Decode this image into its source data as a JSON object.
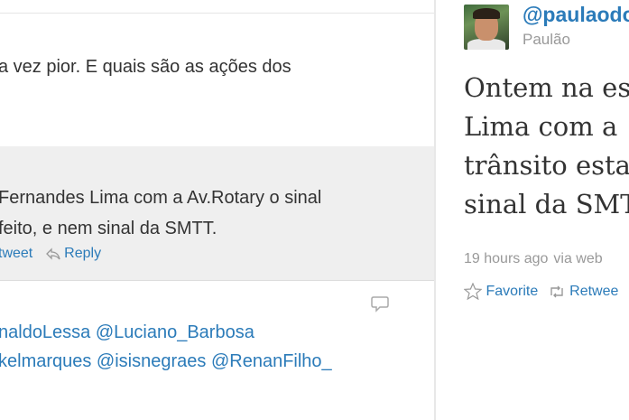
{
  "timeline": {
    "tweet1": {
      "text": "a vez pior. E quais são as ações dos"
    },
    "tweet2": {
      "line1": "Fernandes Lima com a Av.Rotary o sinal",
      "line2": "feito, e nem sinal da SMTT.",
      "retweet": "tweet",
      "reply": "Reply"
    },
    "tweet3": {
      "line1": "naldoLessa @Luciano_Barbosa",
      "line2": "kelmarques @isisnegraes @RenanFilho_"
    }
  },
  "detail": {
    "screen_name": "@paulaodo",
    "real_name": "Paulão",
    "text_lines": [
      "Ontem na es",
      "Lima com a",
      "trânsito esta",
      "sinal da SMT"
    ],
    "timestamp": "19 hours ago",
    "via": "via web",
    "favorite": "Favorite",
    "retweet": "Retwee"
  },
  "colors": {
    "link": "#2b7bb9",
    "muted": "#999999",
    "highlight_bg": "#efefef"
  }
}
